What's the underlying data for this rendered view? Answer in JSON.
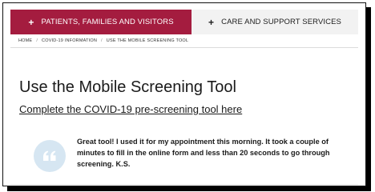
{
  "tabs": [
    {
      "label": "PATIENTS, FAMILIES AND VISITORS",
      "icon": "plus-icon",
      "active": true
    },
    {
      "label": "CARE AND SUPPORT SERVICES",
      "icon": "plus-icon",
      "active": false
    }
  ],
  "breadcrumb": [
    "HOME",
    "COVID-19 INFORMATION",
    "USE THE MOBILE SCREENING TOOL"
  ],
  "breadcrumb_separator": "/",
  "page_title": "Use the Mobile Screening Tool",
  "cta_link": "Complete the COVID-19 pre-screening tool here",
  "testimonial": {
    "quote_icon": "quote-icon",
    "text": "Great tool! I used it for my appointment this morning. It took a couple of minutes to fill in the online form and less than 20 seconds to go through screening. K.S."
  },
  "colors": {
    "accent": "#a41c3f",
    "inactive_tab": "#f2f2f2",
    "quote_circle": "#d6e6f2"
  }
}
